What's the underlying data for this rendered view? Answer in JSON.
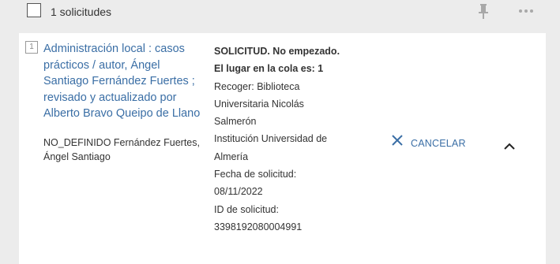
{
  "header": {
    "count_label": "1 solicitudes",
    "pin_icon": "pin-icon",
    "more_icon": "more-horizontal-icon"
  },
  "request": {
    "index": "1",
    "title": "Administración local : casos prácticos / autor, Ángel Santiago Fernández Fuertes ; revisado y actualizado por Alberto Bravo Queipo de Llano",
    "author": "NO_DEFINIDO Fernández Fuertes, Ángel Santiago",
    "status": "SOLICITUD. No empezado. El lugar en la cola es: 1",
    "pickup": "Recoger: Biblioteca Universitaria Nicolás Salmerón",
    "institution": "Institución Universidad de Almería",
    "request_date_label": "Fecha de solicitud:",
    "request_date": "08/11/2022",
    "request_id_label": "ID de solicitud:",
    "request_id": "3398192080004991",
    "cancel_label": "CANCELAR"
  },
  "colors": {
    "link": "#3a6ea5",
    "background": "#ececec",
    "card": "#ffffff"
  }
}
